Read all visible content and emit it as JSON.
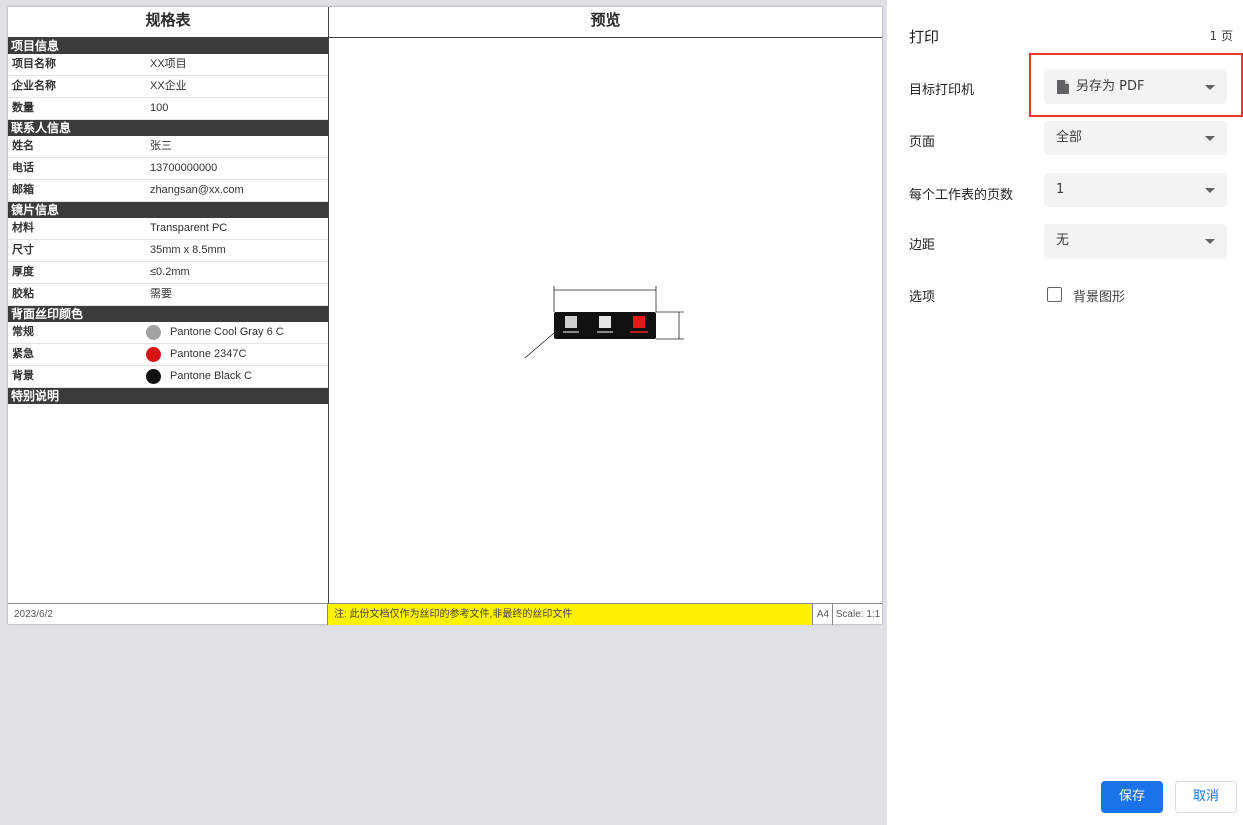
{
  "sheet": {
    "spec_title": "规格表",
    "preview_title": "预览",
    "sections": [
      {
        "title": "项目信息",
        "rows": [
          {
            "key": "项目名称",
            "value": "XX项目"
          },
          {
            "key": "企业名称",
            "value": "XX企业"
          },
          {
            "key": "数量",
            "value": "100"
          }
        ]
      },
      {
        "title": "联系人信息",
        "rows": [
          {
            "key": "姓名",
            "value": "张三"
          },
          {
            "key": "电话",
            "value": "13700000000"
          },
          {
            "key": "邮箱",
            "value": "zhangsan@xx.com"
          }
        ]
      },
      {
        "title": "镜片信息",
        "rows": [
          {
            "key": "材料",
            "value": "Transparent PC"
          },
          {
            "key": "尺寸",
            "value": "35mm x 8.5mm"
          },
          {
            "key": "厚度",
            "value": "≤0.2mm"
          },
          {
            "key": "胶粘",
            "value": "需要"
          }
        ]
      },
      {
        "title": "背面丝印颜色",
        "rows": [
          {
            "key": "常规",
            "value": "Pantone Cool Gray 6 C",
            "swatch": "#a2a2a2"
          },
          {
            "key": "紧急",
            "value": "Pantone 2347C",
            "swatch": "#d61616"
          },
          {
            "key": "背景",
            "value": "Pantone Black C",
            "swatch": "#111111"
          }
        ]
      },
      {
        "title": "特别说明",
        "rows": []
      }
    ],
    "footer": {
      "date": "2023/6/2",
      "note": "注: 此份文档仅作为丝印的参考文件,非最终的丝印文件",
      "paper": "A4",
      "scale": "Scale: 1:1"
    }
  },
  "panel": {
    "title": "打印",
    "page_count": "1 页",
    "printer_label": "目标打印机",
    "printer_value": "另存为 PDF",
    "printer_icon": "document-icon",
    "pages_label": "页面",
    "pages_value": "全部",
    "per_sheet_label": "每个工作表的页数",
    "per_sheet_value": "1",
    "margins_label": "边距",
    "margins_value": "无",
    "options_label": "选项",
    "background_option": "背景图形",
    "save_label": "保存",
    "cancel_label": "取消"
  },
  "colors": {
    "accent": "#1a73e8",
    "highlight": "#e53935",
    "note_bg": "#fff200",
    "section_bg": "#3b3b3e"
  }
}
